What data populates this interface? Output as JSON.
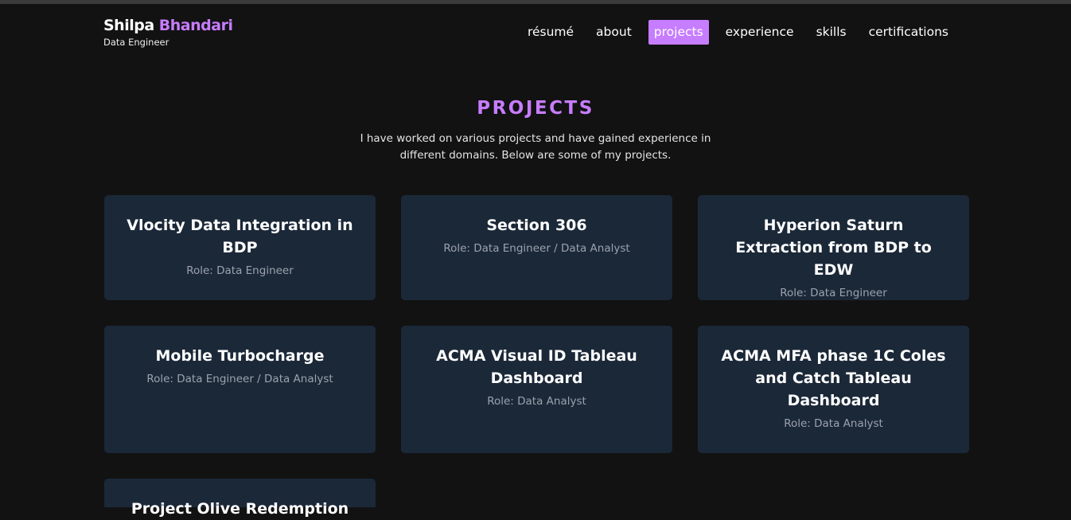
{
  "header": {
    "brand_first": "Shilpa",
    "brand_last": "Bhandari",
    "subtitle": "Data Engineer"
  },
  "nav": {
    "items": [
      {
        "label": "résumé",
        "active": false
      },
      {
        "label": "about",
        "active": false
      },
      {
        "label": "projects",
        "active": true
      },
      {
        "label": "experience",
        "active": false
      },
      {
        "label": "skills",
        "active": false
      },
      {
        "label": "certifications",
        "active": false
      }
    ]
  },
  "projects": {
    "title": "PROJECTS",
    "description": "I have worked on various projects and have gained experience in different domains. Below are some of my projects.",
    "cards": [
      {
        "title": "Vlocity Data Integration in BDP",
        "role": "Role: Data Engineer"
      },
      {
        "title": "Section 306",
        "role": "Role: Data Engineer / Data Analyst"
      },
      {
        "title": "Hyperion Saturn Extraction from BDP to EDW",
        "role": "Role: Data Engineer"
      },
      {
        "title": "Mobile Turbocharge",
        "role": "Role: Data Engineer / Data Analyst"
      },
      {
        "title": "ACMA Visual ID Tableau Dashboard",
        "role": "Role: Data Analyst"
      },
      {
        "title": "ACMA MFA phase 1C Coles and Catch Tableau Dashboard",
        "role": "Role: Data Analyst"
      },
      {
        "title": "Project Olive Redemption",
        "role": ""
      }
    ]
  },
  "colors": {
    "accent": "#c77dff",
    "background": "#121212",
    "card": "#1b2838",
    "role_text": "#9aa3ad"
  }
}
